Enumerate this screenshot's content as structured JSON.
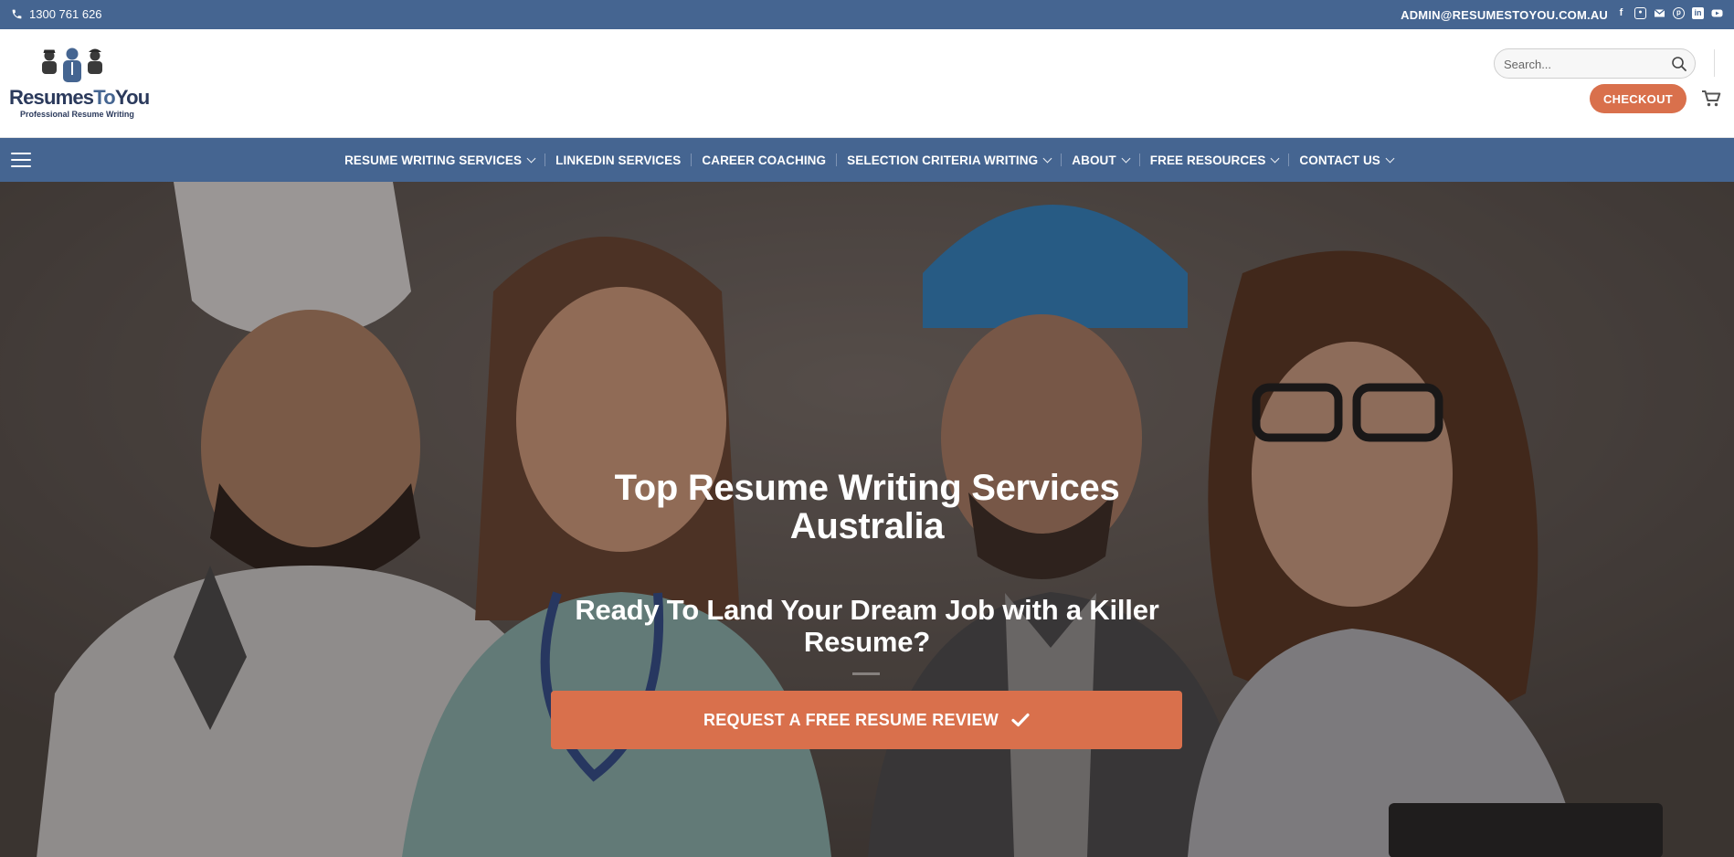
{
  "topbar": {
    "phone": "1300 761 626",
    "email": "ADMIN@RESUMESTOYOU.COM.AU",
    "socials": [
      "facebook-icon",
      "instagram-icon",
      "email-icon",
      "pinterest-icon",
      "linkedin-icon",
      "youtube-icon"
    ]
  },
  "header": {
    "logo_brand_part1": "Resumes",
    "logo_brand_part2": "To",
    "logo_brand_part3": "You",
    "logo_tagline": "Professional Resume Writing",
    "search_placeholder": "Search...",
    "checkout_label": "CHECKOUT"
  },
  "nav": {
    "items": [
      {
        "label": "RESUME WRITING SERVICES",
        "dropdown": true
      },
      {
        "label": "LINKEDIN SERVICES",
        "dropdown": false
      },
      {
        "label": "CAREER COACHING",
        "dropdown": false
      },
      {
        "label": "SELECTION CRITERIA WRITING",
        "dropdown": true
      },
      {
        "label": "ABOUT",
        "dropdown": true
      },
      {
        "label": "FREE RESOURCES",
        "dropdown": true
      },
      {
        "label": "CONTACT US",
        "dropdown": true
      }
    ]
  },
  "hero": {
    "title": "Top Resume Writing Services Australia",
    "subtitle": "Ready To Land Your Dream Job with a Killer Resume?",
    "cta_label": "REQUEST A FREE RESUME REVIEW"
  },
  "colors": {
    "brand_blue": "#456591",
    "accent_orange": "#d9704c"
  }
}
